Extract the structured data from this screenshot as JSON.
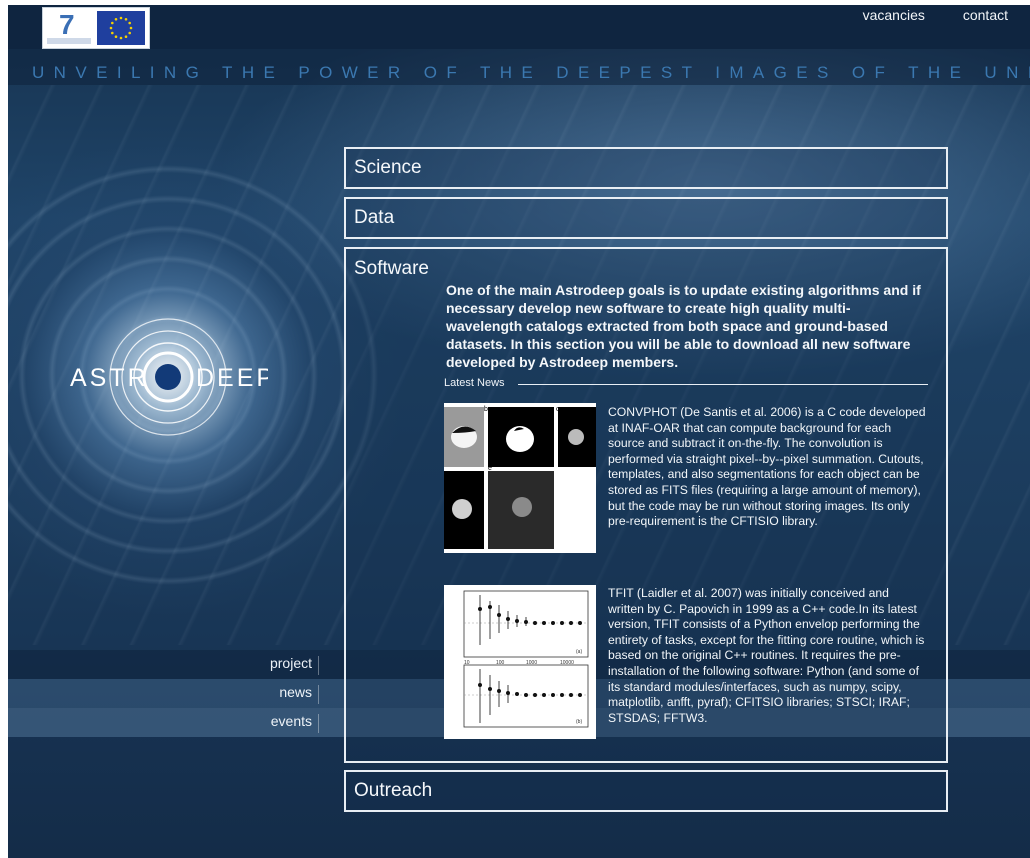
{
  "header": {
    "links": [
      "vacancies",
      "contact"
    ],
    "tagline": "UNVEILING THE POWER OF THE DEEPEST IMAGES OF THE UNIVERSE"
  },
  "logo": {
    "text": "ASTR DEEP"
  },
  "nav": {
    "items": [
      "project",
      "news",
      "events"
    ]
  },
  "sections": {
    "science": "Science",
    "data": "Data",
    "software": "Software",
    "outreach": "Outreach"
  },
  "software": {
    "intro": "One of the main Astrodeep goals is to update existing algorithms and if necessary develop new software to create high quality multi-wavelength catalogs extracted from both space and ground-based datasets. In this section you will be able to download all new software developed by Astrodeep members.",
    "latest_news_label": "Latest News",
    "news": [
      {
        "text": "CONVPHOT (De Santis et al. 2006) is a C code developed at INAF-OAR that can compute background for each source and subtract it on-the-fly. The convolution is performed via straight pixel--by--pixel summation. Cutouts, templates, and also segmentations for each object can be stored as FITS files (requiring a large amount of memory), but the code may be run without storing images. Its only pre-requirement is the CFTISIO library.",
        "image_labels": [
          "b",
          "c",
          "e"
        ]
      },
      {
        "text": "TFIT (Laidler et al. 2007) was initially conceived and written by C. Papovich in 1999 as a C++ code.In its latest version, TFIT consists of a Python envelop performing the entirety of tasks, except for the fitting core routine, which is based on the original C++ routines. It requires the pre- installation of the following software: Python (and some of its standard modules/interfaces, such as numpy, scipy, matplotlib, anfft, pyraf); CFITSIO libraries; STSCI; IRAF; STSDAS; FFTW3.",
        "image_labels": [
          "10",
          "100",
          "1000",
          "10000",
          "(a)",
          "(b)"
        ]
      }
    ]
  },
  "colors": {
    "top_bar": "#0f2540",
    "tagline": "#3b78b0",
    "section_border": "#e8eef4",
    "text": "#f4f7fa"
  }
}
